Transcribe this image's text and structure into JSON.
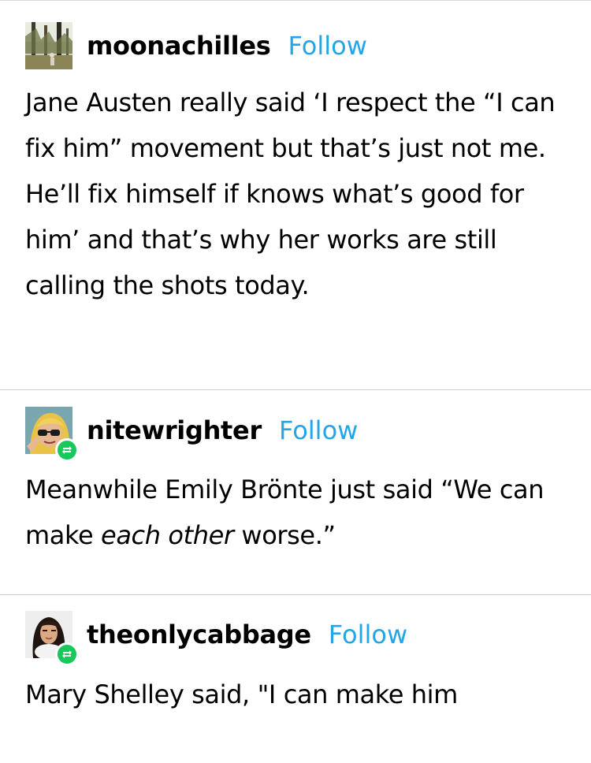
{
  "posts": [
    {
      "username": "moonachilles",
      "follow_label": "Follow",
      "avatar_icon": "forest-photo-avatar",
      "reblog": false,
      "text": "Jane Austen really said ‘I respect the “I can fix him” movement but that’s just not me. He’ll fix himself if knows what’s good for him’ and that’s why her works are still calling the shots today."
    },
    {
      "username": "nitewrighter",
      "follow_label": "Follow",
      "avatar_icon": "illustrated-character-avatar",
      "reblog": true,
      "badge_icon": "reblog-icon",
      "text_before": "Meanwhile Emily Brönte just said “We can make ",
      "text_emphasis": "each other",
      "text_after": " worse.”"
    },
    {
      "username": "theonlycabbage",
      "follow_label": "Follow",
      "avatar_icon": "portrait-photo-avatar",
      "reblog": true,
      "badge_icon": "reblog-icon",
      "text": "Mary Shelley said, \"I can make him"
    }
  ],
  "colors": {
    "follow": "#23a6e8",
    "reblog_badge": "#16c95a",
    "divider": "#cfcfcf",
    "text": "#000000"
  }
}
